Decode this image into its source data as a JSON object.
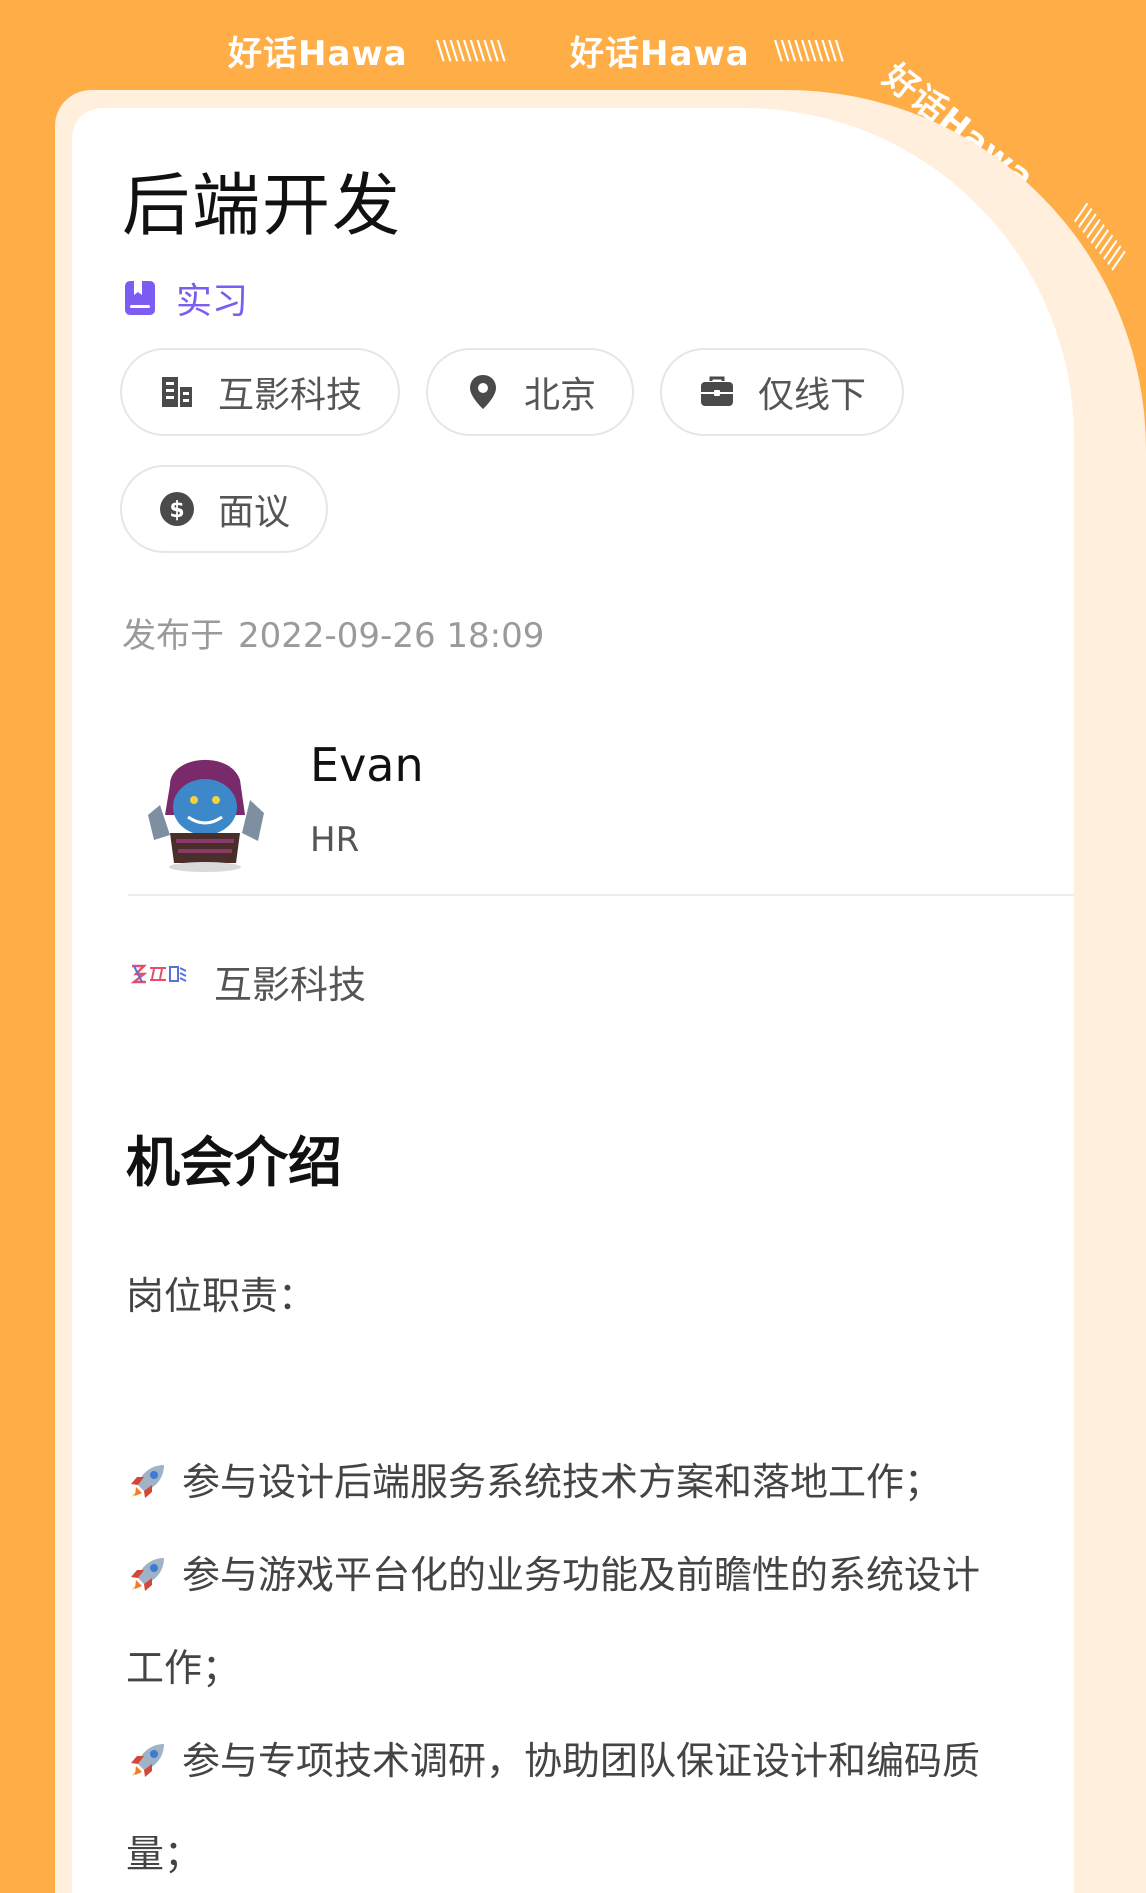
{
  "brand": {
    "text": "好话Hawa",
    "hatch": "\\\\\\\\\\\\\\\\\\\\"
  },
  "job": {
    "title": "后端开发",
    "type_label": "实习",
    "chips": [
      {
        "icon": "building-icon",
        "label": "互影科技"
      },
      {
        "icon": "location-pin-icon",
        "label": "北京"
      },
      {
        "icon": "briefcase-icon",
        "label": "仅线下"
      },
      {
        "icon": "dollar-icon",
        "label": "面议"
      }
    ],
    "publish_prefix": "发布于",
    "publish_date": "2022-09-26 18:09"
  },
  "recruiter": {
    "name": "Evan",
    "role": "HR"
  },
  "company": {
    "name": "互影科技"
  },
  "intro": {
    "title": "机会介绍",
    "heading": "岗位职责：",
    "items": [
      "参与设计后端服务系统技术方案和落地工作；",
      "参与游戏平台化的业务功能及前瞻性的系统设计",
      "工作；",
      "参与专项技术调研，协助团队保证设计和编码质",
      "量；"
    ]
  },
  "colors": {
    "background": "#FFAE47",
    "accent": "#7D5CF1",
    "frame": "#FFEFDC"
  }
}
